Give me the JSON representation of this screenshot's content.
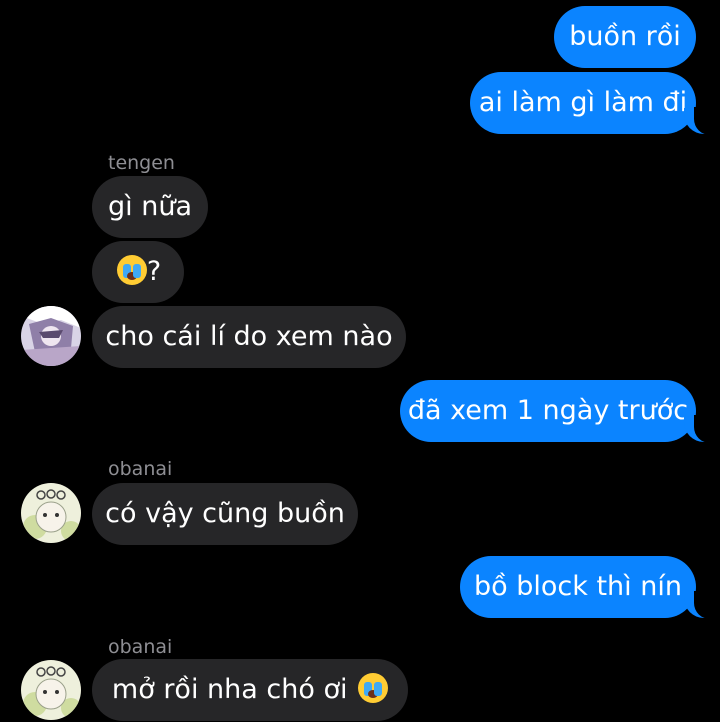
{
  "messages": [
    {
      "sender": "me",
      "text": "buồn rồi"
    },
    {
      "sender": "me",
      "text": "ai làm gì làm đi"
    },
    {
      "sender": "tengen",
      "name": "tengen",
      "text": "gì nữa"
    },
    {
      "sender": "tengen",
      "text": "?",
      "emoji": "loudly-crying-face-emoji"
    },
    {
      "sender": "tengen",
      "text": "cho cái lí do xem nào"
    },
    {
      "sender": "me",
      "text": "đã xem 1 ngày trước"
    },
    {
      "sender": "obanai",
      "name": "obanai",
      "text": "có vậy cũng buồn"
    },
    {
      "sender": "me",
      "text": "bồ block thì nín"
    },
    {
      "sender": "obanai",
      "name": "obanai",
      "text": "mở rồi nha chó ơi",
      "emoji": "loudly-crying-face-emoji"
    }
  ],
  "colors": {
    "outgoing": "#0b84ff",
    "incoming": "#262628",
    "background": "#000000",
    "name": "#8e8e93"
  }
}
